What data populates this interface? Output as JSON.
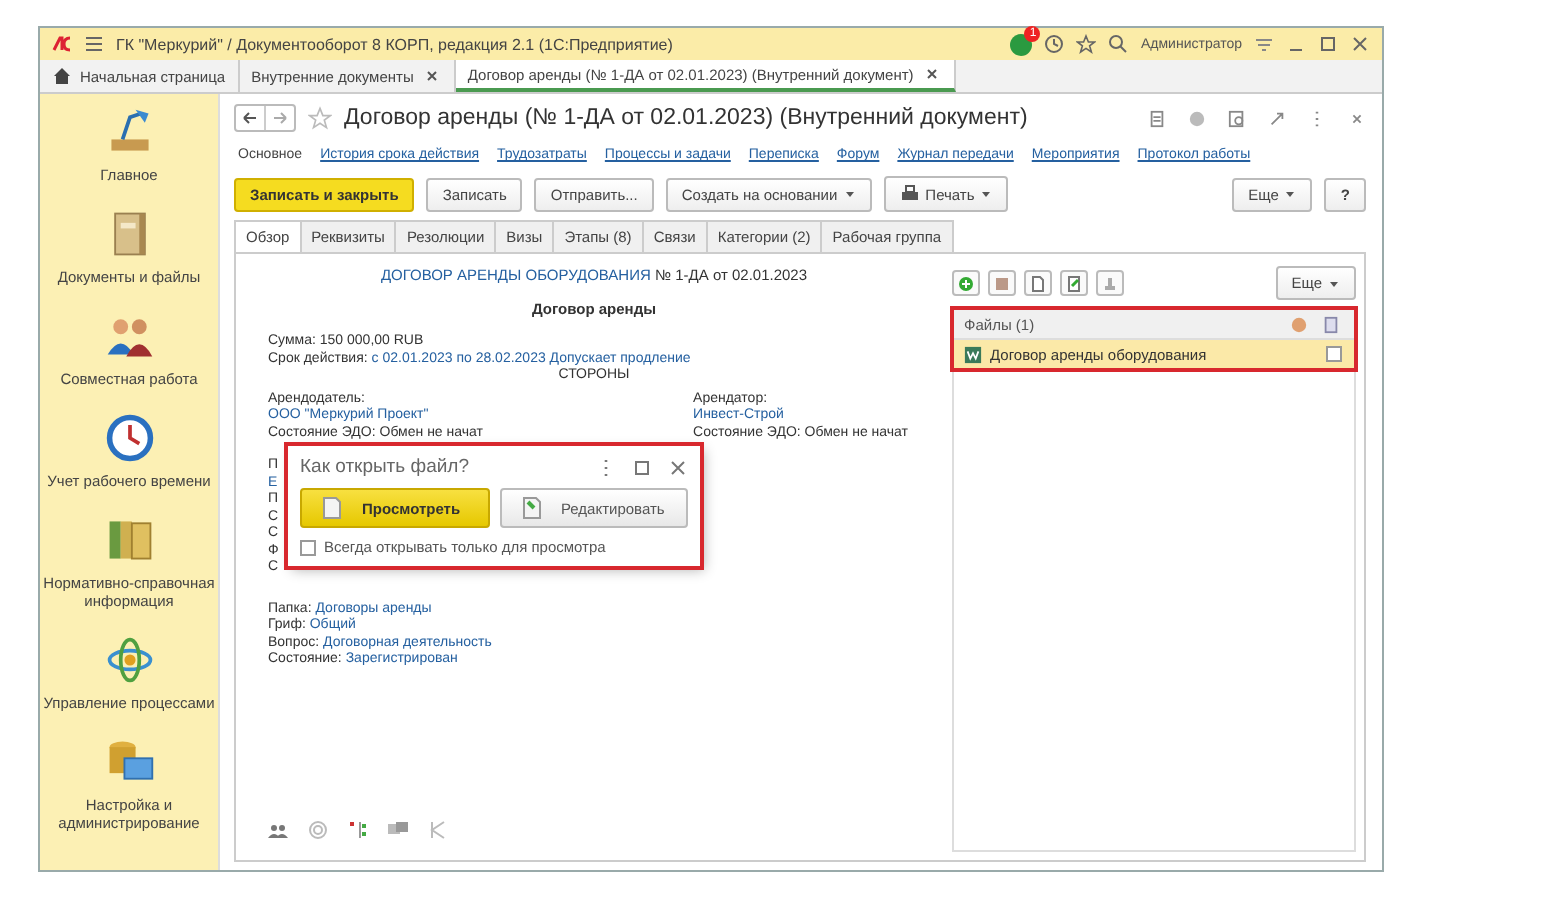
{
  "window": {
    "title": "ГК \"Меркурий\" / Документооборот 8 КОРП, редакция 2.1  (1С:Предприятие)",
    "notification_count": "1",
    "user": "Администратор"
  },
  "tabs": [
    {
      "label": "Начальная страница",
      "kind": "home",
      "selected": false
    },
    {
      "label": "Внутренние документы",
      "kind": "closable",
      "selected": false
    },
    {
      "label": "Договор аренды (№ 1-ДА от 02.01.2023) (Внутренний документ)",
      "kind": "closable",
      "selected": true
    }
  ],
  "sidebar": {
    "items": [
      {
        "label": "Главное",
        "kind": "lamp"
      },
      {
        "label": "Документы и файлы",
        "kind": "binder"
      },
      {
        "label": "Совместная работа",
        "kind": "people"
      },
      {
        "label": "Учет рабочего времени",
        "kind": "clock"
      },
      {
        "label": "Нормативно-справочная информация",
        "kind": "folders"
      },
      {
        "label": "Управление процессами",
        "kind": "orbit"
      },
      {
        "label": "Настройка и администрирование",
        "kind": "computer"
      }
    ]
  },
  "document": {
    "title": "Договор аренды (№ 1-ДА от 02.01.2023) (Внутренний документ)",
    "links": [
      {
        "label": "Основное",
        "selected": true
      },
      {
        "label": "История срока действия",
        "selected": false
      },
      {
        "label": "Трудозатраты",
        "selected": false
      },
      {
        "label": "Процессы и задачи",
        "selected": false
      },
      {
        "label": "Переписка",
        "selected": false
      },
      {
        "label": "Форум",
        "selected": false
      },
      {
        "label": "Журнал передачи",
        "selected": false
      },
      {
        "label": "Мероприятия",
        "selected": false
      },
      {
        "label": "Протокол работы",
        "selected": false
      }
    ],
    "buttons": [
      {
        "label": "Записать и закрыть",
        "kind": "primary"
      },
      {
        "label": "Записать",
        "kind": "plain"
      },
      {
        "label": "Отправить...",
        "kind": "plain"
      },
      {
        "label": "Создать на основании",
        "kind": "dropdown"
      },
      {
        "label": "Печать",
        "kind": "print"
      }
    ],
    "more": "Еще",
    "help": "?",
    "tabs": [
      {
        "label": "Обзор",
        "selected": true
      },
      {
        "label": "Реквизиты",
        "selected": false
      },
      {
        "label": "Резолюции",
        "selected": false
      },
      {
        "label": "Визы",
        "selected": false
      },
      {
        "label": "Этапы (8)",
        "selected": false
      },
      {
        "label": "Связи",
        "selected": false
      },
      {
        "label": "Категории (2)",
        "selected": false
      },
      {
        "label": "Рабочая группа",
        "selected": false
      }
    ]
  },
  "overview": {
    "heading_link": "ДОГОВОР АРЕНДЫ ОБОРУДОВАНИЯ",
    "heading_rest": "№ 1-ДА от 02.01.2023",
    "subtitle": "Договор аренды",
    "sum": "Сумма: 150 000,00 RUB",
    "term_label": "Срок действия:",
    "term_value": "с 02.01.2023 по 28.02.2023 Допускает продление",
    "parties_heading": "СТОРОНЫ",
    "landlord": {
      "label": "Арендодатель:",
      "name": "ООО \"Меркурий Проект\"",
      "edo": "Состояние ЭДО: Обмен не начат"
    },
    "tenant": {
      "label": "Арендатор:",
      "name": "Инвест-Строй",
      "edo": "Состояние ЭДО: Обмен не начат"
    },
    "covered_lines": [
      {
        "text": "П",
        "kind": "plain"
      },
      {
        "text": "Е",
        "kind": "link"
      },
      {
        "text": "П",
        "kind": "plain"
      },
      {
        "text": "С",
        "kind": "plain"
      },
      {
        "text": "С",
        "kind": "plain"
      },
      {
        "text": "Ф",
        "kind": "plain"
      },
      {
        "text": "С",
        "kind": "plain"
      }
    ],
    "fields": [
      {
        "label": "Папка:",
        "value": "Договоры аренды"
      },
      {
        "label": "Гриф:",
        "value": "Общий"
      },
      {
        "label": "Вопрос:",
        "value": "Договорная деятельность"
      },
      {
        "label": "Состояние:",
        "value": "Зарегистрирован"
      }
    ]
  },
  "files": {
    "more": "Еще",
    "header": "Файлы (1)",
    "rows": [
      {
        "name": "Договор аренды оборудования",
        "selected": true,
        "checked": false
      }
    ]
  },
  "dialog": {
    "title": "Как открыть файл?",
    "buttons": [
      {
        "label": "Просмотреть",
        "kind": "primary"
      },
      {
        "label": "Редактировать",
        "kind": "plain"
      }
    ],
    "checkbox": {
      "label": "Всегда открывать только для просмотра",
      "checked": false
    }
  }
}
